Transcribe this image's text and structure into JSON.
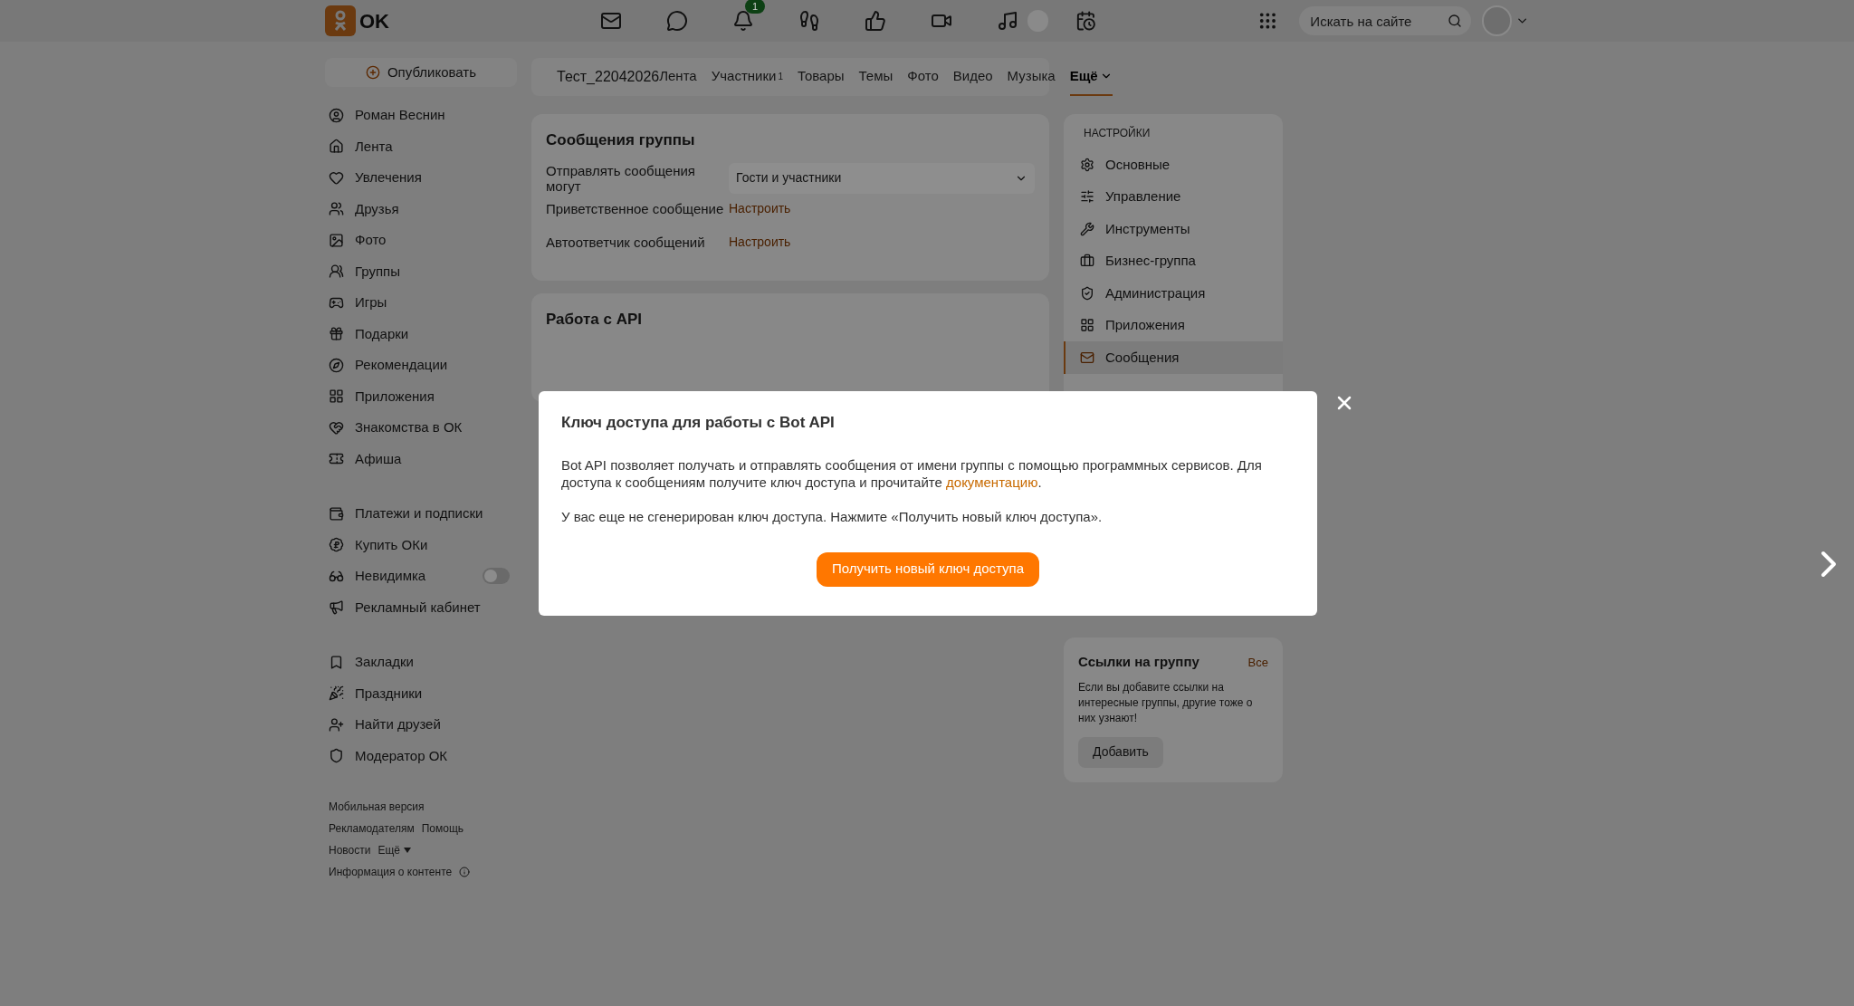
{
  "header": {
    "logo_text": "OK",
    "notification_badge": "1",
    "search_placeholder": "Искать на сайте"
  },
  "sidebar": {
    "publish": "Опубликовать",
    "groups": [
      [
        {
          "label": "Роман Веснин",
          "kind": "link"
        },
        {
          "label": "Лента",
          "kind": "link"
        },
        {
          "label": "Увлечения",
          "kind": "link"
        },
        {
          "label": "Друзья",
          "kind": "link"
        },
        {
          "label": "Фото",
          "kind": "link"
        },
        {
          "label": "Группы",
          "kind": "link"
        },
        {
          "label": "Игры",
          "kind": "link"
        },
        {
          "label": "Подарки",
          "kind": "link"
        },
        {
          "label": "Рекомендации",
          "kind": "link"
        },
        {
          "label": "Приложения",
          "kind": "link"
        },
        {
          "label": "Знакомства в ОК",
          "kind": "link"
        },
        {
          "label": "Афиша",
          "kind": "link"
        }
      ],
      [
        {
          "label": "Платежи и подписки",
          "kind": "link"
        },
        {
          "label": "Купить ОКи",
          "kind": "link"
        },
        {
          "label": "Невидимка",
          "kind": "toggle",
          "on": false
        },
        {
          "label": "Рекламный кабинет",
          "kind": "link"
        }
      ],
      [
        {
          "label": "Закладки",
          "kind": "link"
        },
        {
          "label": "Праздники",
          "kind": "link"
        },
        {
          "label": "Найти друзей",
          "kind": "link"
        },
        {
          "label": "Модератор ОК",
          "kind": "link"
        }
      ]
    ],
    "footer": [
      [
        "Мобильная версия"
      ],
      [
        "Рекламодателям",
        "Помощь"
      ],
      [
        "Новости",
        "Ещё"
      ],
      [
        "Информация о контенте"
      ]
    ]
  },
  "group_header": {
    "name": "Тест_22042026",
    "tabs": [
      {
        "label": "Лента",
        "selected": false
      },
      {
        "label": "Участники",
        "count": "1",
        "selected": false
      },
      {
        "label": "Товары",
        "selected": false
      },
      {
        "label": "Темы",
        "selected": false
      },
      {
        "label": "Фото",
        "selected": false
      },
      {
        "label": "Видео",
        "selected": false
      },
      {
        "label": "Музыка",
        "selected": false
      },
      {
        "label": "Ещё",
        "selected": true
      }
    ]
  },
  "messages_card": {
    "title": "Сообщения группы",
    "rows": [
      {
        "label": "Отправлять сообщения могут",
        "kind": "select",
        "value": "Гости и участники"
      },
      {
        "label": "Приветственное сообщение",
        "kind": "link",
        "value": "Настроить"
      },
      {
        "label": "Автоответчик сообщений",
        "kind": "link",
        "value": "Настроить"
      }
    ]
  },
  "api_card": {
    "title": "Работа с API"
  },
  "settings": {
    "heading": "НАСТРОЙКИ",
    "items": [
      {
        "label": "Основные",
        "selected": false
      },
      {
        "label": "Управление",
        "selected": false
      },
      {
        "label": "Инструменты",
        "selected": false
      },
      {
        "label": "Бизнес-группа",
        "selected": false
      },
      {
        "label": "Администрация",
        "selected": false
      },
      {
        "label": "Приложения",
        "selected": false
      },
      {
        "label": "Сообщения",
        "selected": true
      }
    ]
  },
  "links_card": {
    "title": "Ссылки на группу",
    "all_link": "Все",
    "text": "Если вы добавите ссылки на интересные группы, другие тоже о них узнают!",
    "button": "Добавить"
  },
  "modal": {
    "title": "Ключ доступа для работы с Bot API",
    "intro_text": "Bot API позволяет получать и отправлять сообщения от имени группы с помощью программных сервисов. Для доступа к сообщениям получите ключ доступа и прочитайте",
    "intro_link": "документацию",
    "intro_end": ".",
    "notice": "У вас еще не сгенерирован ключ доступа. Нажмите «Получить новый ключ доступа».",
    "button": "Получить новый ключ доступа"
  }
}
